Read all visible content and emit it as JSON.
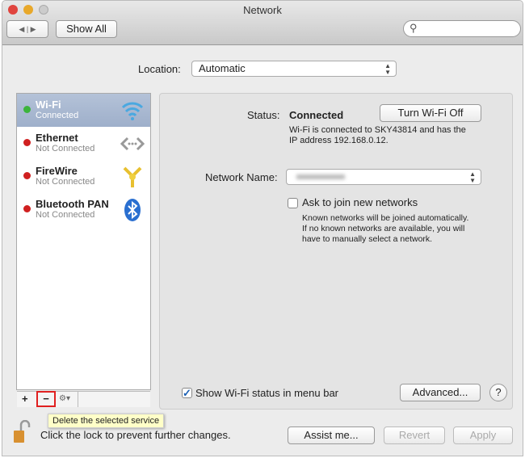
{
  "window": {
    "title": "Network"
  },
  "toolbar": {
    "show_all": "Show All",
    "search_placeholder": ""
  },
  "location": {
    "label": "Location:",
    "value": "Automatic"
  },
  "services": [
    {
      "name": "Wi-Fi",
      "status": "Connected",
      "status_color": "#3cb43c",
      "icon": "wifi-icon"
    },
    {
      "name": "Ethernet",
      "status": "Not Connected",
      "status_color": "#d02020",
      "icon": "ethernet-icon"
    },
    {
      "name": "FireWire",
      "status": "Not Connected",
      "status_color": "#d02020",
      "icon": "firewire-icon"
    },
    {
      "name": "Bluetooth PAN",
      "status": "Not Connected",
      "status_color": "#d02020",
      "icon": "bluetooth-icon"
    }
  ],
  "list_controls": {
    "add": "+",
    "remove": "−",
    "gear": "⚙▾"
  },
  "tooltip": "Delete the selected service",
  "detail": {
    "status_label": "Status:",
    "status_value": "Connected",
    "turn_off": "Turn Wi-Fi Off",
    "status_desc_1": "Wi-Fi is connected to SKY43814 and has the",
    "status_desc_2": "IP address 192.168.0.12.",
    "network_name_label": "Network Name:",
    "ask_join": "Ask to join new networks",
    "ask_join_checked": false,
    "ask_desc_1": "Known networks will be joined automatically.",
    "ask_desc_2": "If no known networks are available, you will",
    "ask_desc_3": "have to manually select a network.",
    "show_status": "Show Wi-Fi status in menu bar",
    "show_status_checked": true,
    "advanced": "Advanced...",
    "help": "?"
  },
  "footer": {
    "lock_text": "Click the lock to prevent further changes.",
    "assist": "Assist me...",
    "revert": "Revert",
    "apply": "Apply"
  }
}
